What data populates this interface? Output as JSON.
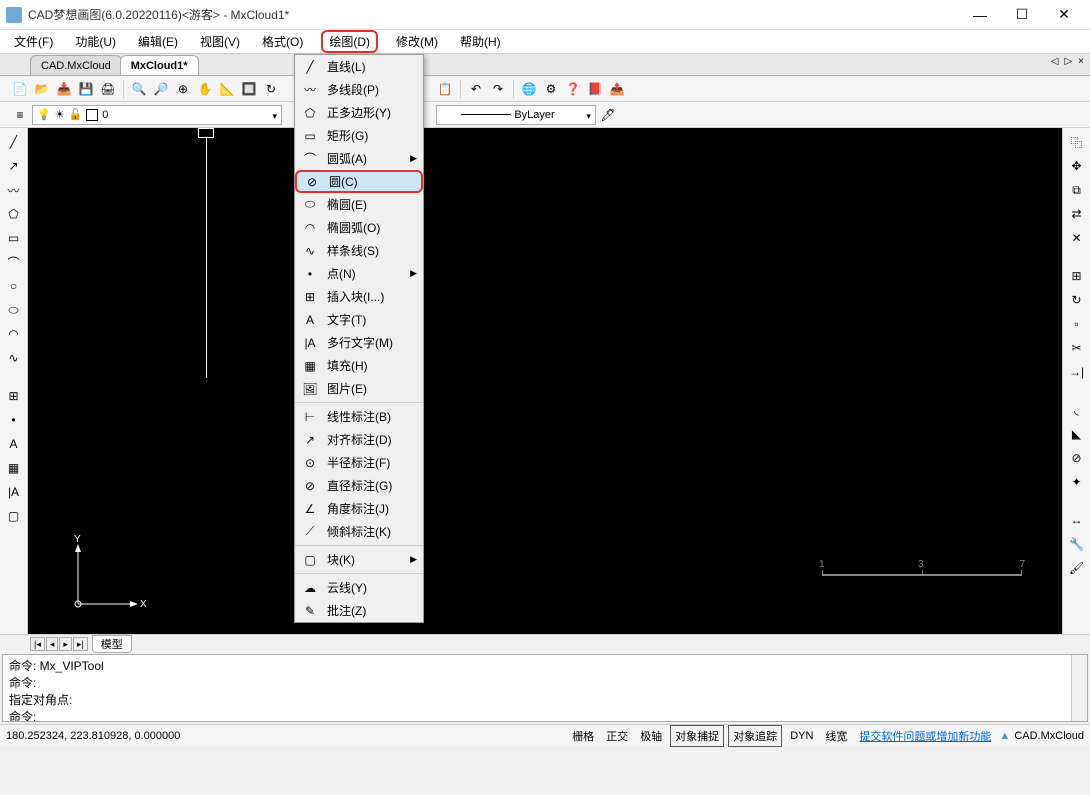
{
  "title": "CAD梦想画图(6.0.20220116)<游客> - MxCloud1*",
  "menu": {
    "file": "文件(F)",
    "func": "功能(U)",
    "edit": "编辑(E)",
    "view": "视图(V)",
    "format": "格式(O)",
    "draw": "绘图(D)",
    "modify": "修改(M)",
    "help": "帮助(H)"
  },
  "tabs": {
    "t1": "CAD.MxCloud",
    "t2": "MxCloud1*"
  },
  "layer_dropdown": "0",
  "bylayer": "ByLayer",
  "bottom_tab": "模型",
  "ruler": {
    "left": "1",
    "mid": "3",
    "right": "7"
  },
  "cmd": "命令: Mx_VIPTool\n命令:\n指定对角点:\n命令:",
  "status": {
    "coords": "180.252324,  223.810928,  0.000000",
    "grid": "栅格",
    "ortho": "正交",
    "polar": "极轴",
    "osnap": "对象捕捉",
    "otrack": "对象追踪",
    "dyn": "DYN",
    "lw": "线宽",
    "feedback": "提交软件问题或增加新功能",
    "brand": "CAD.MxCloud"
  },
  "drawmenu": {
    "line": "直线(L)",
    "pline": "多线段(P)",
    "polygon": "正多边形(Y)",
    "rect": "矩形(G)",
    "arc": "圆弧(A)",
    "circle": "圆(C)",
    "ellipse": "椭圆(E)",
    "elarc": "椭圆弧(O)",
    "spline": "样条线(S)",
    "point": "点(N)",
    "insert": "插入块(I...)",
    "text": "文字(T)",
    "mtext": "多行文字(M)",
    "hatch": "填充(H)",
    "image": "图片(E)",
    "linear": "线性标注(B)",
    "aligned": "对齐标注(D)",
    "radius": "半径标注(F)",
    "diameter": "直径标注(G)",
    "angular": "角度标注(J)",
    "oblique": "倾斜标注(K)",
    "block": "块(K)",
    "revcloud": "云线(Y)",
    "note": "批注(Z)"
  }
}
